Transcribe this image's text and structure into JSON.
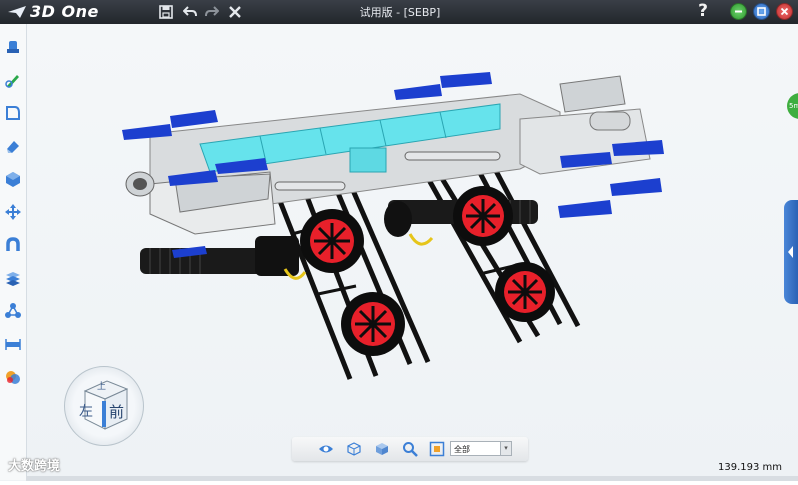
{
  "app": {
    "logo_text": "3D One",
    "window_title": "试用版 - [SEBP]",
    "help_label": "?"
  },
  "quick_access": {
    "icons": [
      "save-icon",
      "undo-icon",
      "redo-icon",
      "close-icon"
    ]
  },
  "window_controls": {
    "colors": {
      "minimize": "#3faa3f",
      "maximize": "#3c7fd0",
      "close": "#d43a3a"
    }
  },
  "left_toolbar": {
    "icons": [
      "basic-solid-icon",
      "sketch-draw-icon",
      "sketch-edit-icon",
      "special-features-icon",
      "combine-icon",
      "move-icon",
      "magnet-icon",
      "pattern-icon",
      "assembly-icon",
      "measure-icon",
      "color-icon"
    ]
  },
  "view_cube": {
    "face_front": "前",
    "face_left": "左",
    "face_top": "上"
  },
  "bottom_toolbar": {
    "icons": [
      "view-eye-icon",
      "wireframe-cube-icon",
      "shaded-cube-icon",
      "zoom-icon",
      "fit-view-icon"
    ],
    "view_filter_value": "全部"
  },
  "status": {
    "measurement": "139.193 mm"
  },
  "watermark": {
    "text": "大数跨境"
  },
  "right_panel": {
    "badge_text": "5m"
  },
  "colors": {
    "titlebar": "#2a2e34",
    "canvas": "#f2f5f7",
    "cyan_glass": "#5fe0ea",
    "missile_blue": "#1c3fcf",
    "wheel_red": "#e8202a"
  }
}
